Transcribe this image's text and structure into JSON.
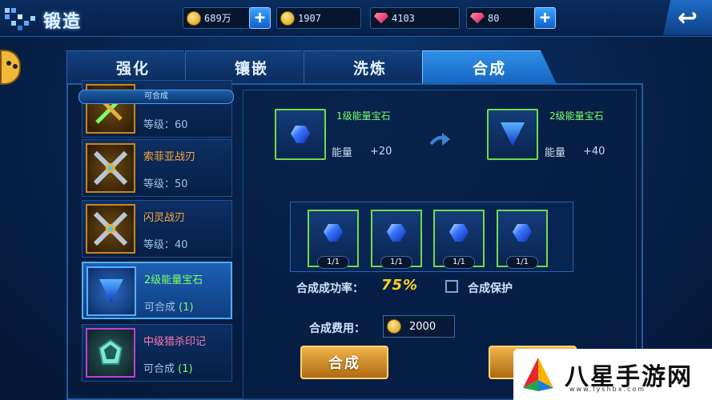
{
  "header": {
    "title": "锻造",
    "resources": [
      {
        "icon": "gold-coin-icon",
        "value": "689万",
        "has_plus": true
      },
      {
        "icon": "gold-coin-icon",
        "value": "1907",
        "has_plus": false
      },
      {
        "icon": "red-gem-icon",
        "value": "4103",
        "has_plus": false
      },
      {
        "icon": "red-gem-icon",
        "value": "80",
        "has_plus": true
      }
    ],
    "plus_label": "+",
    "back_label": "↩"
  },
  "tabs": [
    {
      "label": "强化",
      "active": false
    },
    {
      "label": "镶嵌",
      "active": false
    },
    {
      "label": "洗炼",
      "active": false
    },
    {
      "label": "合成",
      "active": true
    }
  ],
  "list": {
    "header": "可合成",
    "items": [
      {
        "name": "",
        "sub": "等级：60",
        "icon": "weapon-icon"
      },
      {
        "name": "索菲亚战刃",
        "sub": "等级：50",
        "icon": "crossed-blades-icon"
      },
      {
        "name": "闪灵战刃",
        "sub": "等级：40",
        "icon": "crossed-blades-icon"
      },
      {
        "name": "2级能量宝石",
        "sub_prefix": "可合成 ",
        "sub_count": "(1)",
        "icon": "blue-triangle-gem-icon",
        "selected": true
      },
      {
        "name": "中级猎杀印记",
        "sub_prefix": "可合成 ",
        "sub_count": "(1)",
        "icon": "green-crystal-icon"
      }
    ]
  },
  "synthesis": {
    "source": {
      "name": "1级能量宝石",
      "stat_label": "能量",
      "stat_value": "+20"
    },
    "target": {
      "name": "2级能量宝石",
      "stat_label": "能量",
      "stat_value": "+40"
    },
    "materials": [
      {
        "count": "1/1"
      },
      {
        "count": "1/1"
      },
      {
        "count": "1/1"
      },
      {
        "count": "1/1"
      }
    ],
    "rate_label": "合成成功率：",
    "rate_value": "75%",
    "protect_label": "合成保护",
    "cost_label": "合成费用：",
    "cost_value": "2000",
    "synth_button": "合成",
    "second_button": "一"
  },
  "watermark": {
    "text": "八星手游网",
    "url": "www.lyshbx.com"
  }
}
